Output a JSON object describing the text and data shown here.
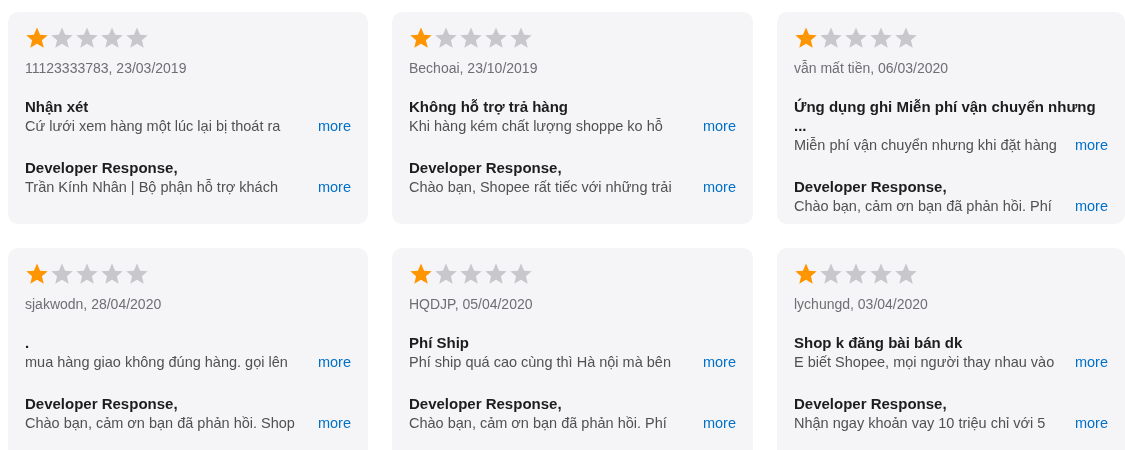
{
  "reviews": [
    {
      "stars": 1,
      "meta": "11123333783, 23/03/2019",
      "title": "Nhận xét",
      "body": "Cứ lưới xem hàng một lúc lại bị thoát ra",
      "more": "more",
      "response_label": "Developer Response,",
      "response_text": "Trần Kính Nhân | Bộ phận hỗ trợ khách",
      "response_more": "more"
    },
    {
      "stars": 1,
      "meta": "Bechoai, 23/10/2019",
      "title": "Không hỗ trợ trả hàng",
      "body": "Khi hàng kém chất lượng shoppe ko hỗ",
      "more": "more",
      "response_label": "Developer Response,",
      "response_text": "Chào bạn, Shopee rất tiếc với những trải",
      "response_more": "more"
    },
    {
      "stars": 1,
      "meta": "vẫn mất tiền, 06/03/2020",
      "title": "Ứng dụng ghi Miễn phí vận chuyển nhưng ...",
      "body": "Miễn phí vận chuyển nhưng khi đặt hàng",
      "more": "more",
      "response_label": "Developer Response,",
      "response_text": "Chào bạn, cảm ơn bạn đã phản hồi. Phí",
      "response_more": "more"
    },
    {
      "stars": 1,
      "meta": "sjakwodn, 28/04/2020",
      "title": ".",
      "body": "mua hàng giao không đúng hàng. gọi lên",
      "more": "more",
      "response_label": "Developer Response,",
      "response_text": "Chào bạn, cảm ơn bạn đã phản hồi. Shop",
      "response_more": "more"
    },
    {
      "stars": 1,
      "meta": "HQDJP, 05/04/2020",
      "title": "Phí Ship",
      "body": "Phí ship quá cao cùng thì Hà nội mà bên",
      "more": "more",
      "response_label": "Developer Response,",
      "response_text": "Chào bạn, cảm ơn bạn đã phản hồi. Phí",
      "response_more": "more"
    },
    {
      "stars": 1,
      "meta": "lychungd, 03/04/2020",
      "title": "Shop k đăng bài bán dk",
      "body": "E biết Shopee, mọi người thay nhau vào",
      "more": "more",
      "response_label": "Developer Response,",
      "response_text": "Nhận ngay khoản vay 10 triệu chỉ với 5",
      "response_more": "more"
    }
  ]
}
